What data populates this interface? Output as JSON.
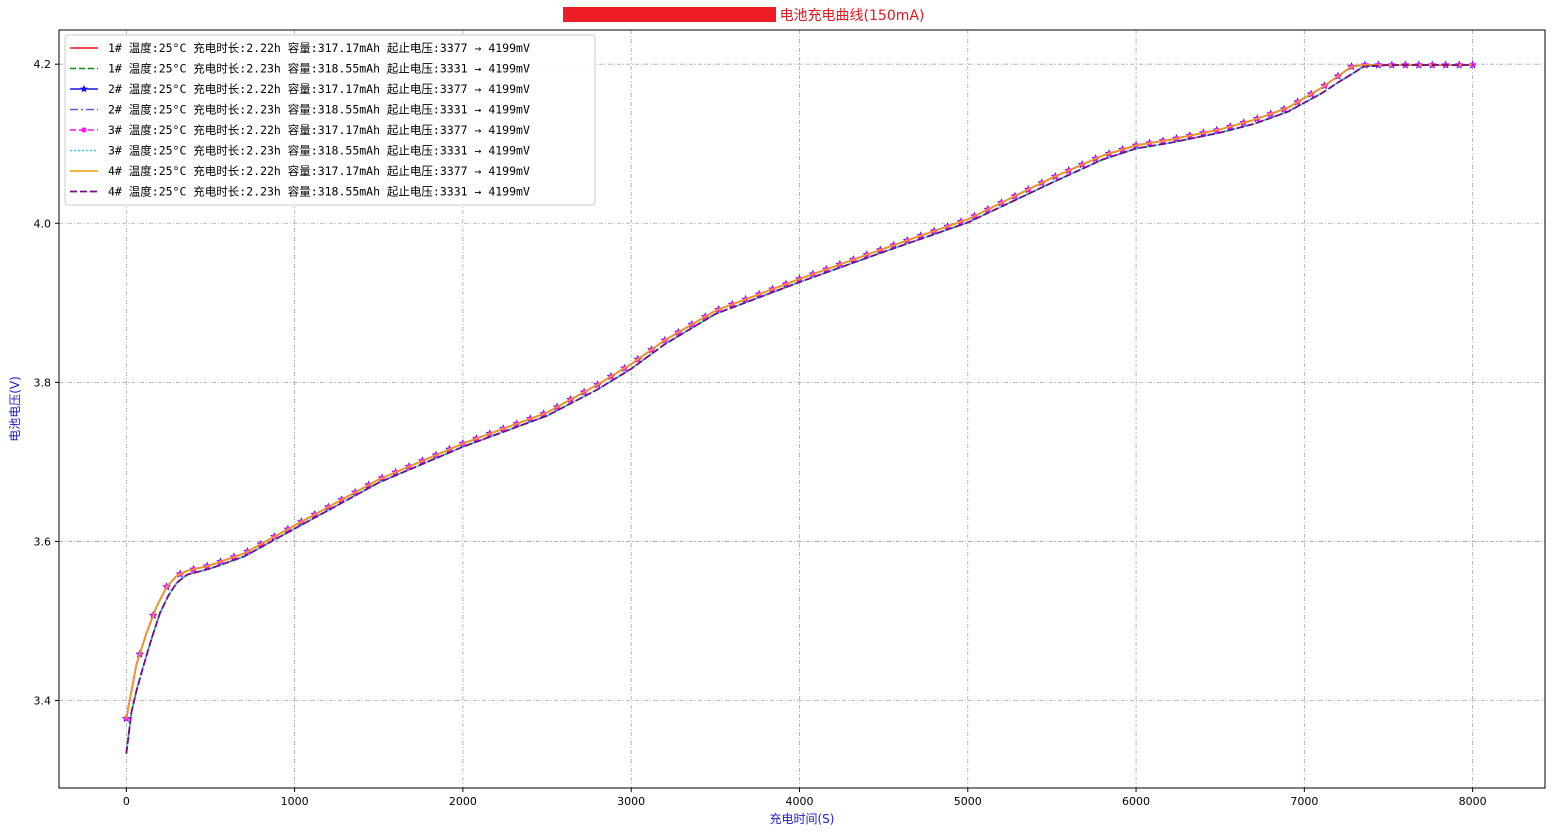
{
  "chart_data": {
    "type": "line",
    "title": "电池充电曲线(150mA)",
    "xlabel": "充电时间(S)",
    "ylabel": "电池电压(V)",
    "xlim": [
      -400,
      8430
    ],
    "ylim": [
      3.29,
      4.243
    ],
    "xticks": [
      0,
      1000,
      2000,
      3000,
      4000,
      5000,
      6000,
      7000,
      8000
    ],
    "yticks": [
      3.4,
      3.6,
      3.8,
      4.0,
      4.2
    ],
    "ytick_labels": [
      "3.4",
      "3.6",
      "3.8",
      "4.0",
      "4.2"
    ],
    "grid": true,
    "legend_position": "top-left",
    "curves": {
      "a": {
        "x": [
          0,
          60,
          120,
          180,
          240,
          300,
          360,
          500,
          700,
          1000,
          1500,
          2000,
          2500,
          2800,
          3000,
          3200,
          3500,
          4000,
          4500,
          5000,
          5500,
          5800,
          6000,
          6200,
          6500,
          6700,
          6900,
          7100,
          7200,
          7280,
          7350,
          7500,
          8000
        ],
        "y": [
          3.3773,
          3.445,
          3.485,
          3.518,
          3.543,
          3.557,
          3.563,
          3.57,
          3.585,
          3.62,
          3.678,
          3.723,
          3.762,
          3.797,
          3.823,
          3.853,
          3.89,
          3.93,
          3.968,
          4.005,
          4.057,
          4.085,
          4.098,
          4.105,
          4.118,
          4.13,
          4.145,
          4.17,
          4.185,
          4.197,
          4.199,
          4.199,
          4.199
        ]
      },
      "b": {
        "x": [
          0,
          30,
          60,
          100,
          150,
          200,
          250,
          300,
          360,
          500,
          700,
          1000,
          1500,
          2000,
          2500,
          2800,
          3000,
          3200,
          3500,
          4000,
          4500,
          5000,
          5500,
          5800,
          6000,
          6200,
          6500,
          6700,
          6900,
          7100,
          7200,
          7300,
          7350,
          7500,
          8000
        ],
        "y": [
          3.3331,
          3.385,
          3.412,
          3.442,
          3.478,
          3.51,
          3.532,
          3.548,
          3.558,
          3.566,
          3.581,
          3.616,
          3.674,
          3.719,
          3.758,
          3.791,
          3.817,
          3.848,
          3.886,
          3.926,
          3.964,
          4.001,
          4.051,
          4.08,
          4.094,
          4.101,
          4.114,
          4.125,
          4.14,
          4.163,
          4.177,
          4.19,
          4.197,
          4.199,
          4.199
        ]
      }
    },
    "series": [
      {
        "name": "1# 温度:25°C  充电时长:2.22h  容量:317.17mAh  起止电压:3377 → 4199mV",
        "curve": "a",
        "color": "#e8141c",
        "dash": "",
        "width": 1.6,
        "marker": "none"
      },
      {
        "name": "1# 温度:25°C  充电时长:2.23h  容量:318.55mAh  起止电压:3331 → 4199mV",
        "curve": "b",
        "color": "#0a8a0a",
        "dash": "6,3",
        "width": 1.6,
        "marker": "none"
      },
      {
        "name": "2# 温度:25°C  充电时长:2.22h  容量:317.17mAh  起止电压:3377 → 4199mV",
        "curve": "a",
        "color": "#1414e6",
        "dash": "",
        "width": 1.6,
        "marker": "star"
      },
      {
        "name": "2# 温度:25°C  充电时长:2.23h  容量:318.55mAh  起止电压:3331 → 4199mV",
        "curve": "b",
        "color": "#6a5acd",
        "dash": "8,3,2,3",
        "width": 1.6,
        "marker": "none"
      },
      {
        "name": "3# 温度:25°C  充电时长:2.22h  容量:317.17mAh  起止电压:3377 → 4199mV",
        "curve": "a",
        "color": "#ff14ff",
        "dash": "6,3",
        "width": 1.6,
        "marker": "dot"
      },
      {
        "name": "3# 温度:25°C  充电时长:2.23h  容量:318.55mAh  起止电压:3331 → 4199mV",
        "curve": "b",
        "color": "#22d8e8",
        "dash": "2,2",
        "width": 1.6,
        "marker": "none"
      },
      {
        "name": "4# 温度:25°C  充电时长:2.22h  容量:317.17mAh  起止电压:3377 → 4199mV",
        "curve": "a",
        "color": "#f5a00a",
        "dash": "",
        "width": 1.6,
        "marker": "none"
      },
      {
        "name": "4# 温度:25°C  充电时长:2.23h  容量:318.55mAh  起止电压:3331 → 4199mV",
        "curve": "b",
        "color": "#7a0a82",
        "dash": "7,3",
        "width": 1.8,
        "marker": "none"
      }
    ]
  }
}
